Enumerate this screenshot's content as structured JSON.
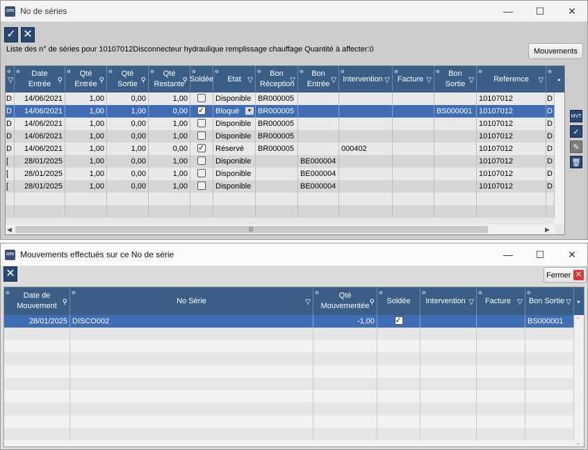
{
  "window1": {
    "title": "No de séries",
    "info": "Liste des n° de séries pour 10107012Disconnecteur hydraulique remplissage chauffage Quantité à affecter:0",
    "mouvements_btn": "Mouvements",
    "side_mvt_label": "MVT",
    "columns": [
      "",
      "Date Entrée",
      "Qté Entrée",
      "Qté Sortie",
      "Qté Restante",
      "Soldée",
      "Etat",
      "Bon Réception",
      "Bon Entrée",
      "Intervention",
      "Facture",
      "Bon Sortie",
      "Reference",
      ""
    ],
    "rows": [
      {
        "c0": "D",
        "date": "14/06/2021",
        "entree": "1,00",
        "sortie": "0,00",
        "restante": "1,00",
        "soldee": false,
        "etat": "Disponible",
        "reception": "BR000005",
        "bentree": "",
        "intervention": "",
        "facture": "",
        "bsortie": "",
        "reference": "10107012",
        "last": "D"
      },
      {
        "c0": "D",
        "date": "14/06/2021",
        "entree": "1,00",
        "sortie": "1,00",
        "restante": "0,00",
        "soldee": true,
        "etat": "Bloqué",
        "reception": "BR000005",
        "bentree": "",
        "intervention": "",
        "facture": "",
        "bsortie": "BS000001",
        "reference": "10107012",
        "last": "D"
      },
      {
        "c0": "D",
        "date": "14/06/2021",
        "entree": "1,00",
        "sortie": "0,00",
        "restante": "1,00",
        "soldee": false,
        "etat": "Disponible",
        "reception": "BR000005",
        "bentree": "",
        "intervention": "",
        "facture": "",
        "bsortie": "",
        "reference": "10107012",
        "last": "D"
      },
      {
        "c0": "D",
        "date": "14/06/2021",
        "entree": "1,00",
        "sortie": "0,00",
        "restante": "1,00",
        "soldee": false,
        "etat": "Disponible",
        "reception": "BR000005",
        "bentree": "",
        "intervention": "",
        "facture": "",
        "bsortie": "",
        "reference": "10107012",
        "last": "D"
      },
      {
        "c0": "D",
        "date": "14/06/2021",
        "entree": "1,00",
        "sortie": "1,00",
        "restante": "0,00",
        "soldee": true,
        "etat": "Réservé",
        "reception": "BR000005",
        "bentree": "",
        "intervention": "000402",
        "facture": "",
        "bsortie": "",
        "reference": "10107012",
        "last": "D"
      },
      {
        "c0": "[",
        "date": "28/01/2025",
        "entree": "1,00",
        "sortie": "0,00",
        "restante": "1,00",
        "soldee": false,
        "etat": "Disponible",
        "reception": "",
        "bentree": "BE000004",
        "intervention": "",
        "facture": "",
        "bsortie": "",
        "reference": "10107012",
        "last": "D"
      },
      {
        "c0": "[",
        "date": "28/01/2025",
        "entree": "1,00",
        "sortie": "0,00",
        "restante": "1,00",
        "soldee": false,
        "etat": "Disponible",
        "reception": "",
        "bentree": "BE000004",
        "intervention": "",
        "facture": "",
        "bsortie": "",
        "reference": "10107012",
        "last": "D"
      },
      {
        "c0": "[",
        "date": "28/01/2025",
        "entree": "1,00",
        "sortie": "0,00",
        "restante": "1,00",
        "soldee": false,
        "etat": "Disponible",
        "reception": "",
        "bentree": "BE000004",
        "intervention": "",
        "facture": "",
        "bsortie": "",
        "reference": "10107012",
        "last": "D"
      }
    ]
  },
  "window2": {
    "title": "Mouvements effectués sur ce No de série",
    "fermer_btn": "Fermer",
    "columns": [
      "Date de Mouvement",
      "No Série",
      "Qté Mouvementée",
      "Soldée",
      "Intervention",
      "Facture",
      "Bon Sortie"
    ],
    "rows": [
      {
        "date": "28/01/2025",
        "serie": "DISCO002",
        "qte": "-1,00",
        "soldee": true,
        "intervention": "",
        "facture": "",
        "bsortie": "BS000001"
      }
    ]
  },
  "colors": {
    "header": "#3a5e85",
    "selection": "#3f6db5",
    "button": "#2a4871"
  }
}
